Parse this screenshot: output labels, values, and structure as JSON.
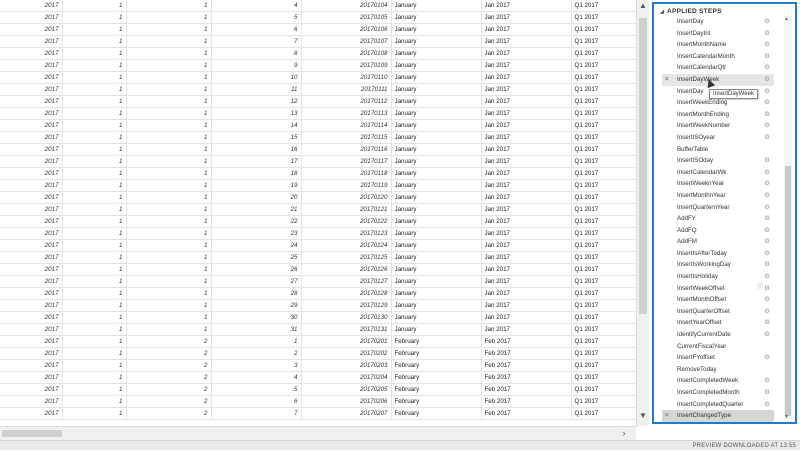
{
  "grid": {
    "rows": [
      [
        "2017",
        "1",
        "1",
        "4",
        "20170104",
        "January",
        "Jan 2017",
        "Q1 2017"
      ],
      [
        "2017",
        "1",
        "1",
        "5",
        "20170105",
        "January",
        "Jan 2017",
        "Q1 2017"
      ],
      [
        "2017",
        "1",
        "1",
        "6",
        "20170106",
        "January",
        "Jan 2017",
        "Q1 2017"
      ],
      [
        "2017",
        "1",
        "1",
        "7",
        "20170107",
        "January",
        "Jan 2017",
        "Q1 2017"
      ],
      [
        "2017",
        "1",
        "1",
        "8",
        "20170108",
        "January",
        "Jan 2017",
        "Q1 2017"
      ],
      [
        "2017",
        "1",
        "1",
        "9",
        "20170109",
        "January",
        "Jan 2017",
        "Q1 2017"
      ],
      [
        "2017",
        "1",
        "1",
        "10",
        "20170110",
        "January",
        "Jan 2017",
        "Q1 2017"
      ],
      [
        "2017",
        "1",
        "1",
        "11",
        "20170111",
        "January",
        "Jan 2017",
        "Q1 2017"
      ],
      [
        "2017",
        "1",
        "1",
        "12",
        "20170112",
        "January",
        "Jan 2017",
        "Q1 2017"
      ],
      [
        "2017",
        "1",
        "1",
        "13",
        "20170113",
        "January",
        "Jan 2017",
        "Q1 2017"
      ],
      [
        "2017",
        "1",
        "1",
        "14",
        "20170114",
        "January",
        "Jan 2017",
        "Q1 2017"
      ],
      [
        "2017",
        "1",
        "1",
        "15",
        "20170115",
        "January",
        "Jan 2017",
        "Q1 2017"
      ],
      [
        "2017",
        "1",
        "1",
        "16",
        "20170116",
        "January",
        "Jan 2017",
        "Q1 2017"
      ],
      [
        "2017",
        "1",
        "1",
        "17",
        "20170117",
        "January",
        "Jan 2017",
        "Q1 2017"
      ],
      [
        "2017",
        "1",
        "1",
        "18",
        "20170118",
        "January",
        "Jan 2017",
        "Q1 2017"
      ],
      [
        "2017",
        "1",
        "1",
        "19",
        "20170119",
        "January",
        "Jan 2017",
        "Q1 2017"
      ],
      [
        "2017",
        "1",
        "1",
        "20",
        "20170120",
        "January",
        "Jan 2017",
        "Q1 2017"
      ],
      [
        "2017",
        "1",
        "1",
        "21",
        "20170121",
        "January",
        "Jan 2017",
        "Q1 2017"
      ],
      [
        "2017",
        "1",
        "1",
        "22",
        "20170122",
        "January",
        "Jan 2017",
        "Q1 2017"
      ],
      [
        "2017",
        "1",
        "1",
        "23",
        "20170123",
        "January",
        "Jan 2017",
        "Q1 2017"
      ],
      [
        "2017",
        "1",
        "1",
        "24",
        "20170124",
        "January",
        "Jan 2017",
        "Q1 2017"
      ],
      [
        "2017",
        "1",
        "1",
        "25",
        "20170125",
        "January",
        "Jan 2017",
        "Q1 2017"
      ],
      [
        "2017",
        "1",
        "1",
        "26",
        "20170126",
        "January",
        "Jan 2017",
        "Q1 2017"
      ],
      [
        "2017",
        "1",
        "1",
        "27",
        "20170127",
        "January",
        "Jan 2017",
        "Q1 2017"
      ],
      [
        "2017",
        "1",
        "1",
        "28",
        "20170128",
        "January",
        "Jan 2017",
        "Q1 2017"
      ],
      [
        "2017",
        "1",
        "1",
        "29",
        "20170129",
        "January",
        "Jan 2017",
        "Q1 2017"
      ],
      [
        "2017",
        "1",
        "1",
        "30",
        "20170130",
        "January",
        "Jan 2017",
        "Q1 2017"
      ],
      [
        "2017",
        "1",
        "1",
        "31",
        "20170131",
        "January",
        "Jan 2017",
        "Q1 2017"
      ],
      [
        "2017",
        "1",
        "2",
        "1",
        "20170201",
        "February",
        "Feb 2017",
        "Q1 2017"
      ],
      [
        "2017",
        "1",
        "2",
        "2",
        "20170202",
        "February",
        "Feb 2017",
        "Q1 2017"
      ],
      [
        "2017",
        "1",
        "2",
        "3",
        "20170203",
        "February",
        "Feb 2017",
        "Q1 2017"
      ],
      [
        "2017",
        "1",
        "2",
        "4",
        "20170204",
        "February",
        "Feb 2017",
        "Q1 2017"
      ],
      [
        "2017",
        "1",
        "2",
        "5",
        "20170205",
        "February",
        "Feb 2017",
        "Q1 2017"
      ],
      [
        "2017",
        "1",
        "2",
        "6",
        "20170206",
        "February",
        "Feb 2017",
        "Q1 2017"
      ],
      [
        "2017",
        "1",
        "2",
        "7",
        "20170207",
        "February",
        "Feb 2017",
        "Q1 2017"
      ]
    ],
    "column_types": [
      "num",
      "num",
      "num",
      "num",
      "num",
      "txt",
      "txt",
      "txt"
    ]
  },
  "steps_panel": {
    "title": "APPLIED STEPS",
    "tooltip": "InsertDayWeek",
    "steps": [
      {
        "label": "InsertDay",
        "gear": true,
        "x": false,
        "info": false,
        "state": ""
      },
      {
        "label": "InsertDayInt",
        "gear": true,
        "x": false,
        "info": false,
        "state": ""
      },
      {
        "label": "InsertMonthName",
        "gear": true,
        "x": false,
        "info": false,
        "state": ""
      },
      {
        "label": "InsertCalendarMonth",
        "gear": true,
        "x": false,
        "info": false,
        "state": ""
      },
      {
        "label": "InsertCalendarQtr",
        "gear": true,
        "x": false,
        "info": false,
        "state": ""
      },
      {
        "label": "InsertDayWeek",
        "gear": true,
        "x": true,
        "info": false,
        "state": "hover"
      },
      {
        "label": "InsertDay",
        "gear": true,
        "x": false,
        "info": false,
        "state": ""
      },
      {
        "label": "InsertWeekEnding",
        "gear": true,
        "x": false,
        "info": false,
        "state": ""
      },
      {
        "label": "InsertMonthEnding",
        "gear": true,
        "x": false,
        "info": false,
        "state": ""
      },
      {
        "label": "InsertWeekNumber",
        "gear": true,
        "x": false,
        "info": false,
        "state": ""
      },
      {
        "label": "InsertISOyear",
        "gear": true,
        "x": false,
        "info": false,
        "state": ""
      },
      {
        "label": "BufferTable",
        "gear": false,
        "x": false,
        "info": false,
        "state": ""
      },
      {
        "label": "InsertISOday",
        "gear": true,
        "x": false,
        "info": false,
        "state": ""
      },
      {
        "label": "InsertCalendarWk",
        "gear": true,
        "x": false,
        "info": false,
        "state": ""
      },
      {
        "label": "InsertWeeknYear",
        "gear": true,
        "x": false,
        "info": false,
        "state": ""
      },
      {
        "label": "InsertMonthnYear",
        "gear": true,
        "x": false,
        "info": false,
        "state": ""
      },
      {
        "label": "InsertQuarternYear",
        "gear": true,
        "x": false,
        "info": false,
        "state": ""
      },
      {
        "label": "AddFY",
        "gear": true,
        "x": false,
        "info": false,
        "state": ""
      },
      {
        "label": "AddFQ",
        "gear": true,
        "x": false,
        "info": false,
        "state": ""
      },
      {
        "label": "AddFM",
        "gear": true,
        "x": false,
        "info": false,
        "state": ""
      },
      {
        "label": "InsertIsAfterToday",
        "gear": true,
        "x": false,
        "info": false,
        "state": ""
      },
      {
        "label": "InsertIsWorkingDay",
        "gear": true,
        "x": false,
        "info": false,
        "state": ""
      },
      {
        "label": "InsertIsHoliday",
        "gear": true,
        "x": false,
        "info": false,
        "state": ""
      },
      {
        "label": "InsertWeekOffset",
        "gear": true,
        "x": false,
        "info": true,
        "state": ""
      },
      {
        "label": "InsertMonthOffset",
        "gear": true,
        "x": false,
        "info": false,
        "state": ""
      },
      {
        "label": "InsertQuarterOffset",
        "gear": true,
        "x": false,
        "info": false,
        "state": ""
      },
      {
        "label": "InsertYearOffset",
        "gear": true,
        "x": false,
        "info": false,
        "state": ""
      },
      {
        "label": "IdentifyCurrentDate",
        "gear": true,
        "x": false,
        "info": false,
        "state": ""
      },
      {
        "label": "CurrentFiscalYear",
        "gear": false,
        "x": false,
        "info": false,
        "state": ""
      },
      {
        "label": "InsertFYoffset",
        "gear": true,
        "x": false,
        "info": false,
        "state": ""
      },
      {
        "label": "RemoveToday",
        "gear": false,
        "x": false,
        "info": false,
        "state": ""
      },
      {
        "label": "InsertCompletedWeek",
        "gear": true,
        "x": false,
        "info": false,
        "state": ""
      },
      {
        "label": "InsertCompletedMonth",
        "gear": true,
        "x": false,
        "info": false,
        "state": ""
      },
      {
        "label": "InsertCompletedQuarter",
        "gear": true,
        "x": false,
        "info": false,
        "state": ""
      },
      {
        "label": "InsertChangedType",
        "gear": false,
        "x": true,
        "info": false,
        "state": "selected"
      }
    ]
  },
  "status": {
    "text": "PREVIEW DOWNLOADED AT 13:55"
  }
}
